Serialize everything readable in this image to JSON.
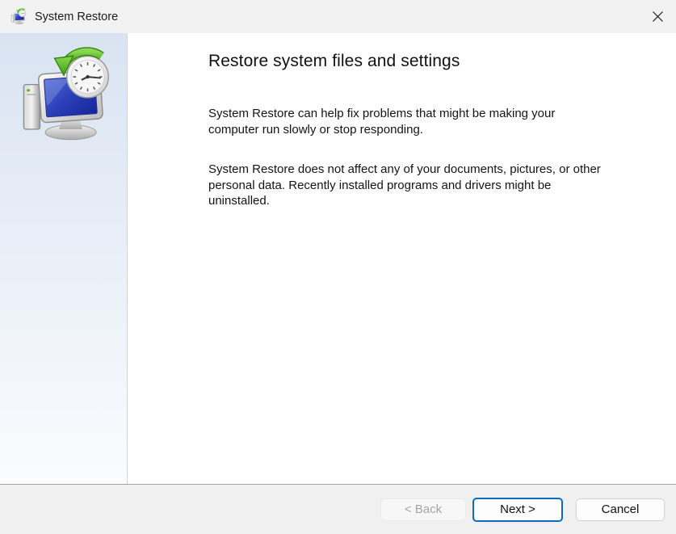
{
  "window": {
    "title": "System Restore"
  },
  "icons": {
    "app_icon": "system-restore-icon (monitor with clock and green restore arrow)",
    "close_icon": "✕"
  },
  "header": {
    "title": "Restore system files and settings"
  },
  "main": {
    "paragraph1_lines": [
      "System Restore can help fix problems that might be making your",
      "computer run slowly or stop responding."
    ],
    "paragraph2_lines": [
      "System Restore does not affect any of your documents, pictures, or other",
      "personal data. Recently installed programs and drivers might be",
      "uninstalled."
    ]
  },
  "footer": {
    "back_label": "< Back",
    "next_label": "Next >",
    "cancel_label": "Cancel"
  },
  "colors": {
    "titlebar_bg": "#f2f2f2",
    "sidebar_gradient_top": "#d9e3f1",
    "sidebar_gradient_bottom": "#fafcfe",
    "footer_bg": "#f0f0f0",
    "footer_separator": "#a3a3a3",
    "accent_button_border": "#0b6bc3",
    "screen_blue": "#2a3fb8",
    "arrow_green": "#5cbf2a"
  }
}
